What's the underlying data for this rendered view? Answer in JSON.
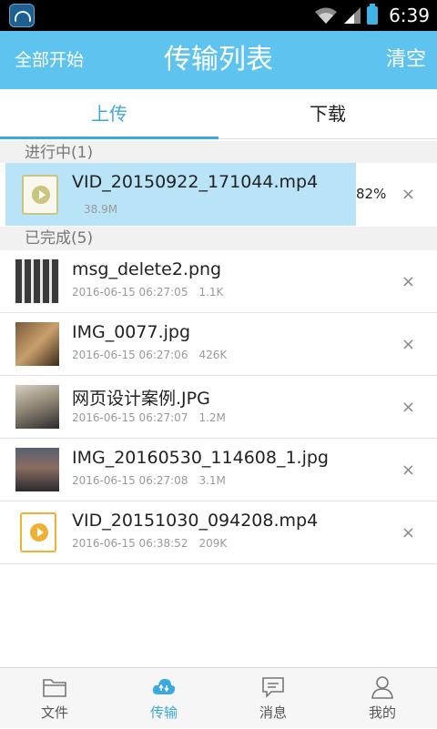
{
  "status_bar": {
    "time": "6:39"
  },
  "header": {
    "start_all": "全部开始",
    "title": "传输列表",
    "clear": "清空"
  },
  "tabs": [
    {
      "label": "上传",
      "active": true
    },
    {
      "label": "下载",
      "active": false
    }
  ],
  "in_progress": {
    "header": "进行中(1)",
    "items": [
      {
        "name": "VID_20150922_171044.mp4",
        "size": "38.9M",
        "progress": 0.82,
        "percent": "82%",
        "thumb": "video-icon"
      }
    ]
  },
  "completed": {
    "header": "已完成(5)",
    "items": [
      {
        "name": "msg_delete2.png",
        "date": "2016-06-15 06:27:05",
        "size": "1.1K",
        "thumb": "image"
      },
      {
        "name": "IMG_0077.jpg",
        "date": "2016-06-15 06:27:06",
        "size": "426K",
        "thumb": "photo"
      },
      {
        "name": "网页设计案例.JPG",
        "date": "2016-06-15 06:27:07",
        "size": "1.2M",
        "thumb": "photo"
      },
      {
        "name": "IMG_20160530_114608_1.jpg",
        "date": "2016-06-15 06:27:08",
        "size": "3.1M",
        "thumb": "photo"
      },
      {
        "name": "VID_20151030_094208.mp4",
        "date": "2016-06-15 06:38:52",
        "size": "209K",
        "thumb": "video-icon"
      }
    ]
  },
  "close_glyph": "×",
  "bottom_nav": [
    {
      "label": "文件",
      "icon": "folder-icon",
      "active": false
    },
    {
      "label": "传输",
      "icon": "cloud-transfer-icon",
      "active": true
    },
    {
      "label": "消息",
      "icon": "message-icon",
      "active": false
    },
    {
      "label": "我的",
      "icon": "person-icon",
      "active": false
    }
  ],
  "colors": {
    "accent": "#5ec3ee",
    "active_tab": "#39a9e0",
    "progress_fill": "#b9e3f6"
  }
}
